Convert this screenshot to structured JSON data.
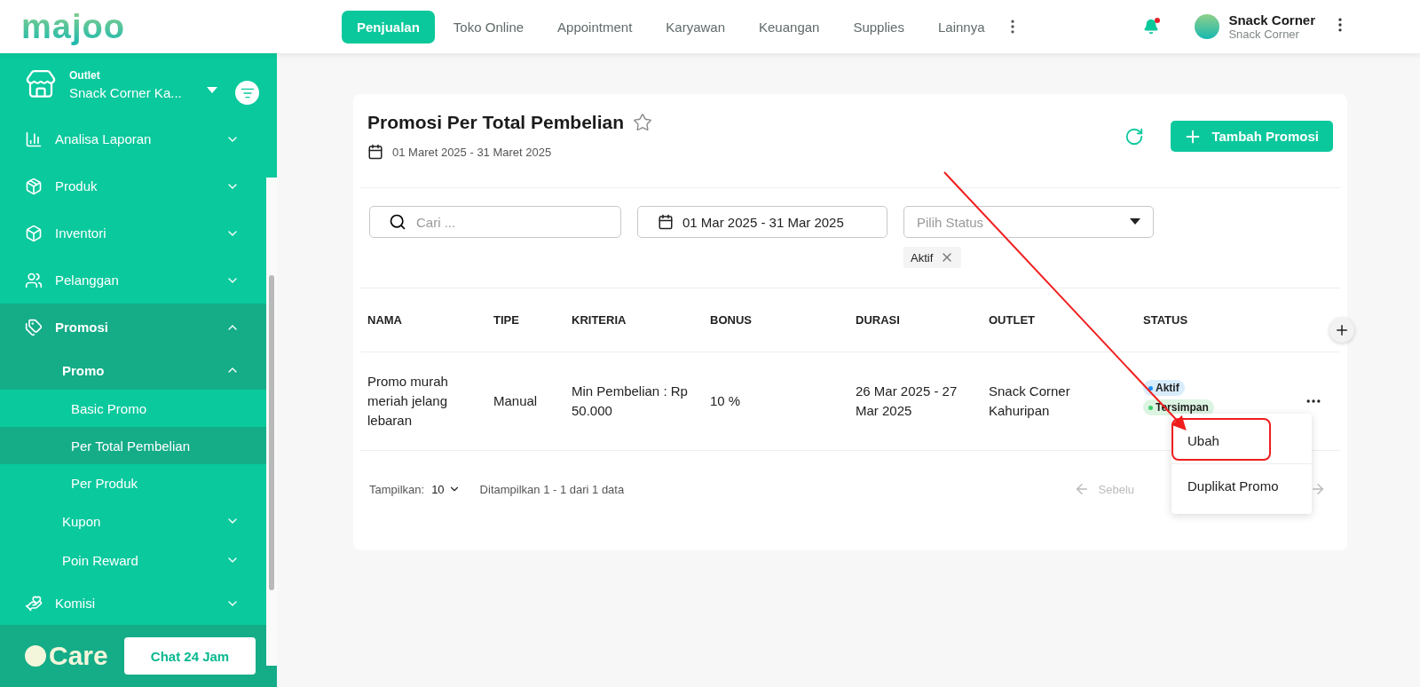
{
  "header": {
    "logo": "majoo",
    "tabs": [
      {
        "label": "Penjualan",
        "selected": true
      },
      {
        "label": "Toko Online",
        "selected": false
      },
      {
        "label": "Appointment",
        "selected": false
      },
      {
        "label": "Karyawan",
        "selected": false
      },
      {
        "label": "Keuangan",
        "selected": false
      },
      {
        "label": "Supplies",
        "selected": false
      },
      {
        "label": "Lainnya",
        "selected": false
      }
    ],
    "notification": true,
    "user": {
      "name": "Snack Corner",
      "subtitle": "Snack Corner"
    }
  },
  "sidebar": {
    "outlet": {
      "label": "Outlet",
      "value": "Snack Corner Ka..."
    },
    "items": [
      {
        "label": "Analisa Laporan",
        "expanded": false
      },
      {
        "label": "Produk",
        "expanded": false
      },
      {
        "label": "Inventori",
        "expanded": false
      },
      {
        "label": "Pelanggan",
        "expanded": false
      },
      {
        "label": "Promosi",
        "expanded": true,
        "children": [
          {
            "label": "Promo",
            "expanded": true,
            "children": [
              {
                "label": "Basic Promo",
                "selected": false
              },
              {
                "label": "Per Total Pembelian",
                "selected": true
              },
              {
                "label": "Per Produk",
                "selected": false
              }
            ]
          },
          {
            "label": "Kupon",
            "expanded": false
          },
          {
            "label": "Poin Reward",
            "expanded": false
          }
        ]
      },
      {
        "label": "Komisi",
        "expanded": false
      }
    ],
    "care": {
      "logo": "Care",
      "button": "Chat 24 Jam"
    }
  },
  "page": {
    "title": "Promosi Per Total Pembelian",
    "period": "01 Maret 2025 - 31 Maret 2025",
    "add_button": "Tambah Promosi",
    "filters": {
      "search_placeholder": "Cari ...",
      "date_range": "01 Mar 2025 - 31 Mar 2025",
      "status_placeholder": "Pilih Status",
      "chips": [
        "Aktif"
      ]
    },
    "table": {
      "columns": [
        "NAMA",
        "TIPE",
        "KRITERIA",
        "BONUS",
        "DURASI",
        "OUTLET",
        "STATUS"
      ],
      "rows": [
        {
          "cells": [
            "Promo murah meriah jelang lebaran",
            "Manual",
            "Min Pembelian : Rp 50.000",
            "10 %",
            "26 Mar 2025 - 27 Mar 2025",
            "Snack Corner Kahuripan"
          ],
          "statuses": [
            {
              "label": "Aktif",
              "color": "#1e90ff"
            },
            {
              "label": "Tersimpan",
              "color": "#3ccf6b"
            }
          ]
        }
      ]
    },
    "menu": [
      {
        "label": "Ubah",
        "highlighted": true
      },
      {
        "label": "Duplikat Promo",
        "highlighted": false
      }
    ],
    "footer": {
      "show_label": "Tampilkan:",
      "page_size": "10",
      "summary": "Ditampilkan 1 - 1 dari 1 data",
      "prev": "Sebelu"
    }
  }
}
